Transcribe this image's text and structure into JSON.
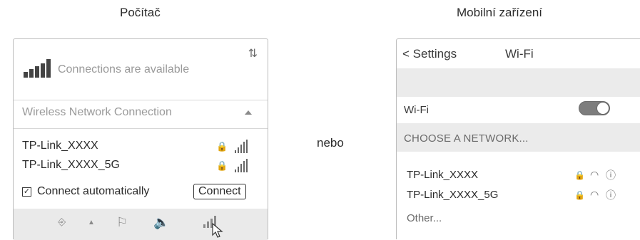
{
  "captions": {
    "left": "Počítač",
    "right": "Mobilní zařízení"
  },
  "separator": "nebo",
  "pc": {
    "refresh_icon": "refresh-icon",
    "status_text": "Connections are available",
    "connection_title": "Wireless Network Connection",
    "networks": [
      {
        "ssid": "TP-Link_XXXX",
        "secured": true,
        "signal_icon": "signal-icon"
      },
      {
        "ssid": "TP-Link_XXXX_5G",
        "secured": true,
        "signal_icon": "signal-icon"
      }
    ],
    "auto_connect": {
      "label": "Connect automatically",
      "checked": true,
      "check_mark": "✓"
    },
    "connect_label": "Connect",
    "taskbar_icons": [
      "network-icon",
      "show-hidden-icon",
      "action-center-icon",
      "volume-icon",
      "wifi-tray-icon"
    ]
  },
  "mobile": {
    "back_label": "< Settings",
    "title": "Wi-Fi",
    "wifi_label": "Wi-Fi",
    "wifi_on": true,
    "choose_header": "CHOOSE A NETWORK...",
    "networks": [
      {
        "ssid": "TP-Link_XXXX",
        "icons": [
          "lock-icon",
          "wifi-icon",
          "info-icon"
        ]
      },
      {
        "ssid": "TP-Link_XXXX_5G",
        "icons": [
          "lock-icon",
          "wifi-icon",
          "info-icon"
        ]
      }
    ],
    "other_label": "Other..."
  }
}
